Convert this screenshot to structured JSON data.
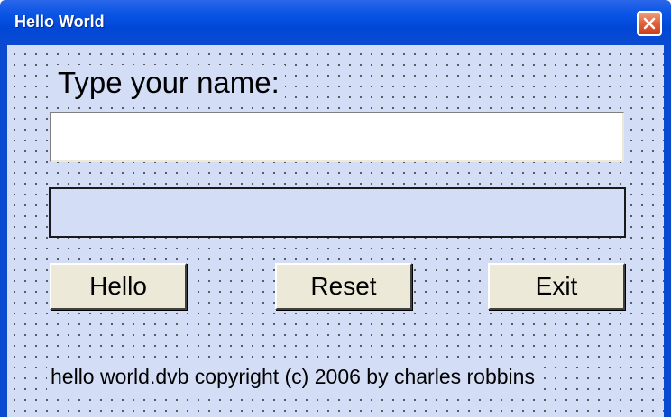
{
  "window": {
    "title": "Hello World"
  },
  "form": {
    "prompt_label": "Type your name:",
    "name_input": {
      "value": "",
      "placeholder": ""
    },
    "output_text": ""
  },
  "buttons": {
    "hello_label": "Hello",
    "reset_label": "Reset",
    "exit_label": "Exit"
  },
  "footer": {
    "copyright_text": "hello world.dvb copyright (c) 2006 by charles robbins"
  },
  "icons": {
    "close": "close-icon"
  },
  "colors": {
    "titlebar": "#0a4ad0",
    "client_background": "#d3def6",
    "button_face": "#ece9d8",
    "close_button": "#e0603a"
  }
}
